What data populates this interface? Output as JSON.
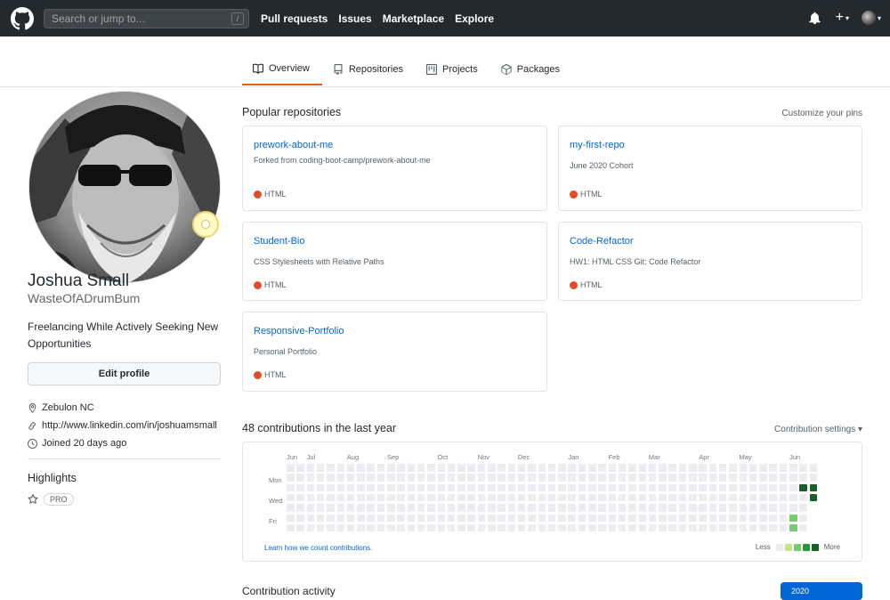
{
  "header": {
    "search_placeholder": "Search or jump to...",
    "slash_hint": "/",
    "nav": [
      "Pull requests",
      "Issues",
      "Marketplace",
      "Explore"
    ]
  },
  "tabs": [
    {
      "label": "Overview",
      "icon": "book-icon",
      "active": true
    },
    {
      "label": "Repositories",
      "icon": "repo-icon",
      "active": false
    },
    {
      "label": "Projects",
      "icon": "project-icon",
      "active": false
    },
    {
      "label": "Packages",
      "icon": "package-icon",
      "active": false
    }
  ],
  "profile": {
    "full_name": "Joshua Small",
    "username": "WasteOfADrumBum",
    "bio": "Freelancing While Actively Seeking New Opportunities",
    "edit_label": "Edit profile",
    "location": "Zebulon NC",
    "website": "http://www.linkedin.com/in/joshuamsmall",
    "joined": "Joined 20 days ago",
    "highlights_title": "Highlights",
    "pro_badge": "PRO"
  },
  "popular": {
    "title": "Popular repositories",
    "customize": "Customize your pins",
    "repos": [
      {
        "name": "prework-about-me",
        "desc": "Forked from coding-boot-camp/prework-about-me",
        "lang": "HTML"
      },
      {
        "name": "my-first-repo",
        "desc": "June 2020 Cohort",
        "lang": "HTML"
      },
      {
        "name": "Student-Bio",
        "desc": "CSS Stylesheets with Relative Paths",
        "lang": "HTML"
      },
      {
        "name": "Code-Refactor",
        "desc": "HW1: HTML CSS Git: Code Refactor",
        "lang": "HTML"
      },
      {
        "name": "Responsive-Portfolio",
        "desc": "Personal Portfolio",
        "lang": "HTML"
      }
    ]
  },
  "contributions": {
    "title": "48 contributions in the last year",
    "settings": "Contribution settings ▾",
    "months": [
      "Jun",
      "Jul",
      "Aug",
      "Sep",
      "Oct",
      "Nov",
      "Dec",
      "Jan",
      "Feb",
      "Mar",
      "Apr",
      "May",
      "Jun"
    ],
    "days": [
      "Mon",
      "Wed",
      "Fri"
    ],
    "learn": "Learn how we count contributions.",
    "less": "Less",
    "more": "More",
    "colors": [
      "#ebedf0",
      "#c6e48b",
      "#7bc96f",
      "#239a3b",
      "#196127"
    ]
  },
  "activity": {
    "title": "Contribution activity",
    "year": "2020"
  }
}
